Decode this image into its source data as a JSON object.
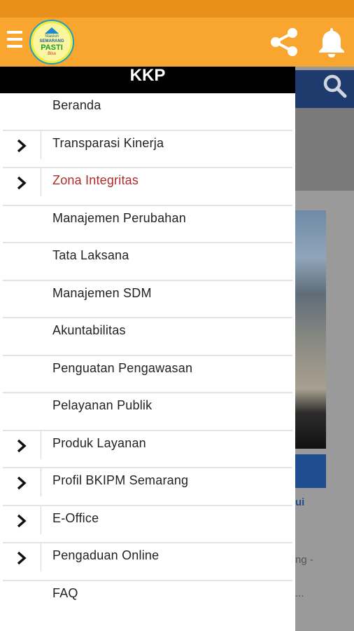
{
  "drawer": {
    "title": "KKP",
    "items": [
      {
        "label": "Beranda",
        "has_children": false,
        "active": false
      },
      {
        "label": "Transparasi Kinerja",
        "has_children": true,
        "active": false
      },
      {
        "label": "Zona Integritas",
        "has_children": true,
        "active": true
      },
      {
        "label": "Manajemen Perubahan",
        "has_children": false,
        "active": false
      },
      {
        "label": "Tata Laksana",
        "has_children": false,
        "active": false
      },
      {
        "label": "Manajemen SDM",
        "has_children": false,
        "active": false
      },
      {
        "label": "Akuntabilitas",
        "has_children": false,
        "active": false
      },
      {
        "label": "Penguatan Pengawasan",
        "has_children": false,
        "active": false
      },
      {
        "label": "Pelayanan Publik",
        "has_children": false,
        "active": false
      },
      {
        "label": "Produk Layanan",
        "has_children": true,
        "active": false
      },
      {
        "label": "Profil BKIPM Semarang",
        "has_children": true,
        "active": false
      },
      {
        "label": "E-Office",
        "has_children": true,
        "active": false
      },
      {
        "label": "Pengaduan Online",
        "has_children": true,
        "active": false
      },
      {
        "label": "FAQ",
        "has_children": false,
        "active": false
      }
    ]
  },
  "header": {
    "logo": {
      "line1": "Stasiun",
      "line2": "SEMARANG",
      "line3": "PASTI",
      "line4": "Bisa"
    },
    "icons": [
      "menu-icon",
      "share-icon",
      "bell-icon"
    ]
  },
  "background_page": {
    "text1": "ui",
    "text2": "ng -",
    "text3": "..."
  },
  "colors": {
    "status_bar": "#e8901a",
    "header": "#f9a630",
    "drawer_title_bg": "#000000",
    "active_item": "#b02a2a",
    "navbar": "#1f3a6c"
  }
}
